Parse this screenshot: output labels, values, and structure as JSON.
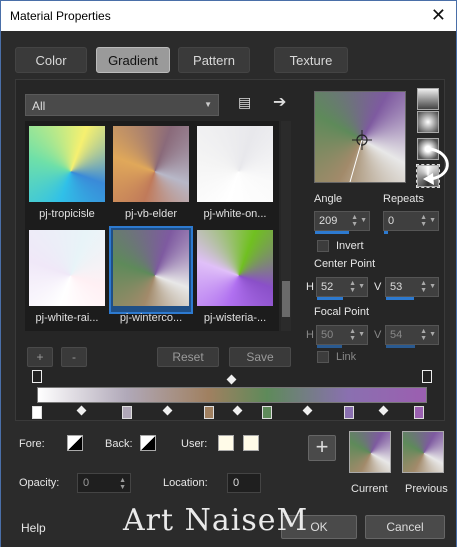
{
  "window": {
    "title": "Material Properties",
    "close_glyph": "✕"
  },
  "tabs": [
    "Color",
    "Gradient",
    "Pattern",
    "Texture"
  ],
  "library": {
    "category": "All",
    "items": [
      {
        "label": "pj-tropicisle",
        "colors": [
          "#30c0e8",
          "#6fe0a8",
          "#f6f070",
          "#3a8ad8"
        ]
      },
      {
        "label": "pj-vb-elder",
        "colors": [
          "#c07a5a",
          "#e0a85a",
          "#8a6a7a",
          "#b8b8c8"
        ]
      },
      {
        "label": "pj-white-on...",
        "colors": [
          "#ffffff",
          "#f4f4f4",
          "#e8e8ec",
          "#fafafa"
        ]
      },
      {
        "label": "pj-white-rai...",
        "colors": [
          "#ffffff",
          "#f0e8f8",
          "#e8f4f8",
          "#fff0f4"
        ]
      },
      {
        "label": "pj-winterco...",
        "colors": [
          "#a28a6a",
          "#5e8a5a",
          "#7e5aa0",
          "#e8e8e8"
        ],
        "selected": true
      },
      {
        "label": "pj-wisteria-...",
        "colors": [
          "#b070f0",
          "#e0c0f8",
          "#70c020",
          "#8a50c8"
        ]
      }
    ]
  },
  "list_buttons": {
    "add": "+",
    "remove": "-",
    "reset": "Reset",
    "save": "Save"
  },
  "angle": {
    "label": "Angle",
    "value": "209"
  },
  "repeats": {
    "label": "Repeats",
    "value": "0"
  },
  "invert": {
    "label": "Invert"
  },
  "center_point": {
    "label": "Center Point",
    "h_label": "H",
    "h_value": "52",
    "v_label": "V",
    "v_value": "53"
  },
  "focal_point": {
    "label": "Focal Point",
    "h_label": "H",
    "h_value": "50",
    "v_label": "V",
    "v_value": "54"
  },
  "link": {
    "label": "Link"
  },
  "stops": [
    {
      "color": "#ffffff"
    },
    {
      "color": "#b0a8b8"
    },
    {
      "color": "#a08060"
    },
    {
      "color": "#5e8a5a"
    },
    {
      "color": "#8a70b0"
    },
    {
      "color": "#9a60b0"
    }
  ],
  "fore": {
    "label": "Fore:"
  },
  "back": {
    "label": "Back:"
  },
  "user": {
    "label": "User:"
  },
  "opacity": {
    "label": "Opacity:",
    "value": "0"
  },
  "location": {
    "label": "Location:",
    "value": "0"
  },
  "current": {
    "label": "Current"
  },
  "previous": {
    "label": "Previous"
  },
  "buttons": {
    "help": "Help",
    "ok": "OK",
    "cancel": "Cancel"
  },
  "watermark": "Art NaiseM",
  "colors": {
    "accent": "#2d7ad0"
  }
}
